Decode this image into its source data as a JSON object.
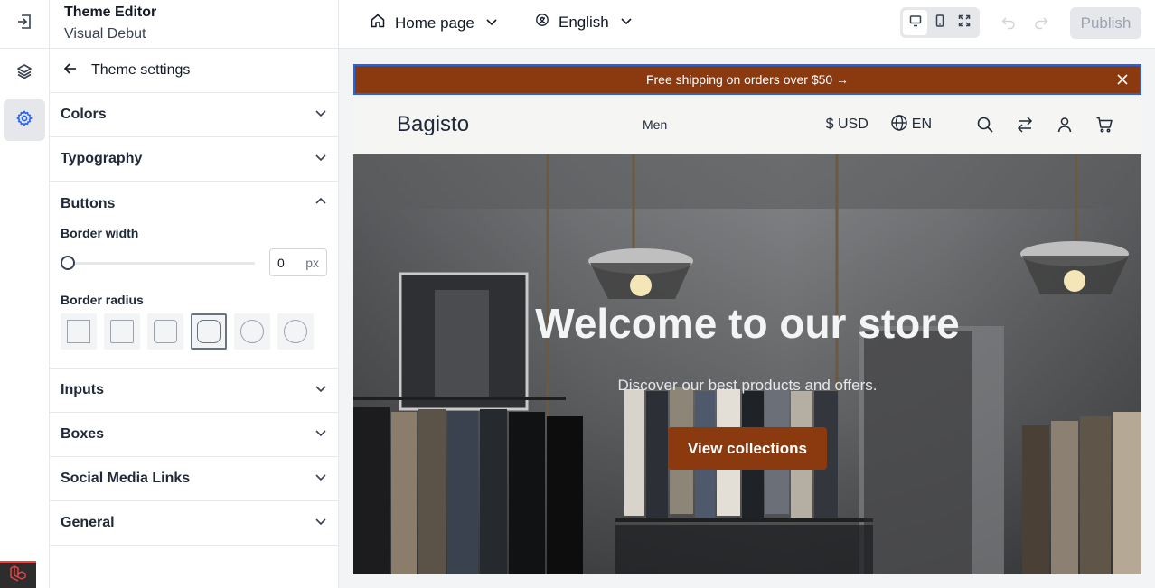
{
  "editor": {
    "title": "Theme Editor",
    "theme_name": "Visual Debut"
  },
  "rail": {
    "icons": [
      "exit-icon",
      "layers-icon",
      "gear-icon"
    ]
  },
  "panel": {
    "back_label": "Theme settings",
    "sections": [
      {
        "label": "Colors",
        "open": false
      },
      {
        "label": "Typography",
        "open": false
      },
      {
        "label": "Buttons",
        "open": true
      },
      {
        "label": "Inputs",
        "open": false
      },
      {
        "label": "Boxes",
        "open": false
      },
      {
        "label": "Social Media Links",
        "open": false
      },
      {
        "label": "General",
        "open": false
      }
    ],
    "buttons": {
      "border_width_label": "Border width",
      "border_width_value": "0",
      "border_width_unit": "px",
      "border_width_fraction": 0,
      "border_radius_label": "Border radius",
      "radius_options": [
        "none",
        "small",
        "medium",
        "large",
        "x-large",
        "full"
      ],
      "radius_selected": "large"
    }
  },
  "topbar": {
    "page_select": "Home page",
    "locale_select": "English",
    "devices": [
      "desktop",
      "mobile",
      "fullscreen"
    ],
    "active_device": "desktop",
    "publish_label": "Publish"
  },
  "preview": {
    "announcement": "Free shipping on orders over $50 →",
    "brand": "Bagisto",
    "nav_link": "Men",
    "currency": "$ USD",
    "language": "EN",
    "hero_title": "Welcome to our store",
    "hero_subtitle": "Discover our best products and offers.",
    "hero_cta": "View collections",
    "accent_color": "#8b3a0f",
    "selection_color": "#2563eb"
  }
}
